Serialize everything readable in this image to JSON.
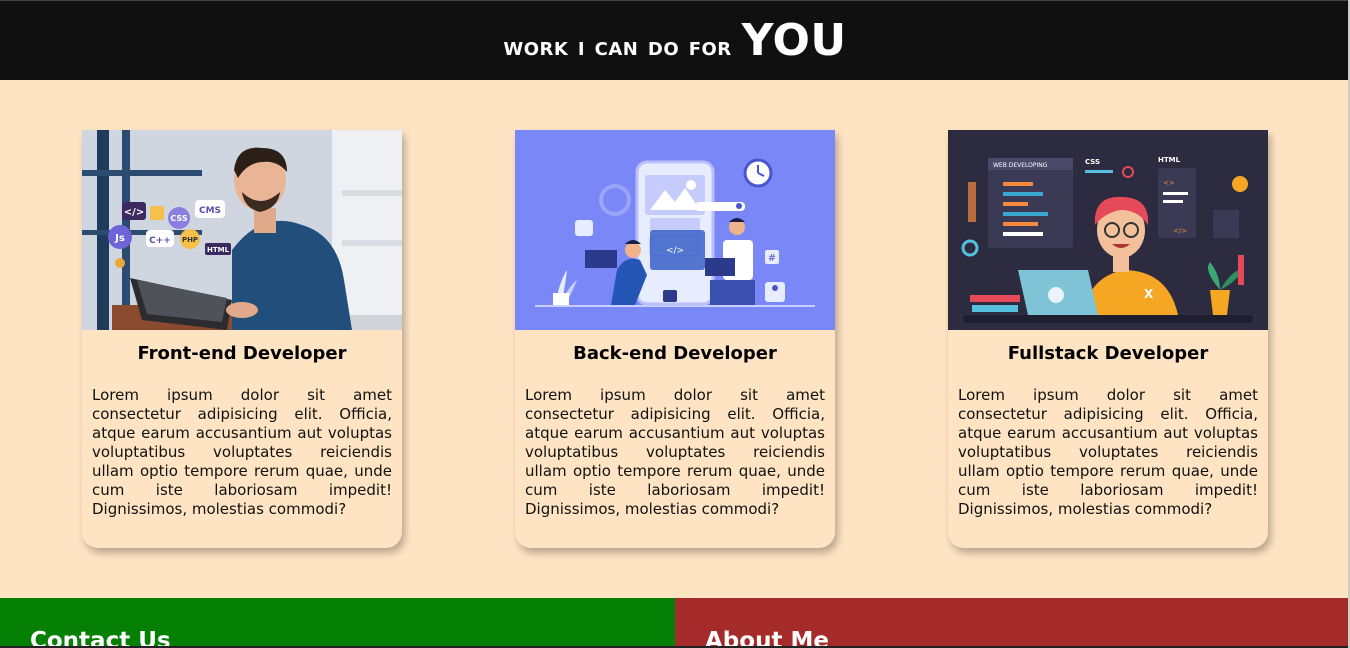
{
  "header": {
    "title_prefix": "work i can do for",
    "title_emphasis": "YOU"
  },
  "cards": [
    {
      "title": "Front-end Developer",
      "text": "Lorem ipsum dolor sit amet consectetur adipisicing elit. Officia, atque earum accusantium aut voluptas voluptatibus voluptates reiciendis ullam optio tempore rerum quae, unde cum iste laboriosam impedit! Dignissimos, molestias commodi?",
      "image_badges": [
        "</>",
        "CSS",
        "CMS",
        "Js",
        "C++",
        "PHP",
        "HTML"
      ]
    },
    {
      "title": "Back-end Developer",
      "text": "Lorem ipsum dolor sit amet consectetur adipisicing elit. Officia, atque earum accusantium aut voluptas voluptatibus voluptates reiciendis ullam optio tempore rerum quae, unde cum iste laboriosam impedit! Dignissimos, molestias commodi?",
      "image_badges": [
        "</>",
        "#"
      ]
    },
    {
      "title": "Fullstack Developer",
      "text": "Lorem ipsum dolor sit amet consectetur adipisicing elit. Officia, atque earum accusantium aut voluptas voluptatibus voluptates reiciendis ullam optio tempore rerum quae, unde cum iste laboriosam impedit! Dignissimos, molestias commodi?",
      "image_badges": [
        "WEB DEVELOPING",
        "CSS",
        "HTML",
        "</>",
        "X"
      ]
    }
  ],
  "footer": {
    "contact_heading": "Contact Us",
    "about_heading": "About Me"
  },
  "colors": {
    "background": "#FFE4C4",
    "header": "#101010",
    "contact": "#058005",
    "about": "#A52A2A"
  }
}
